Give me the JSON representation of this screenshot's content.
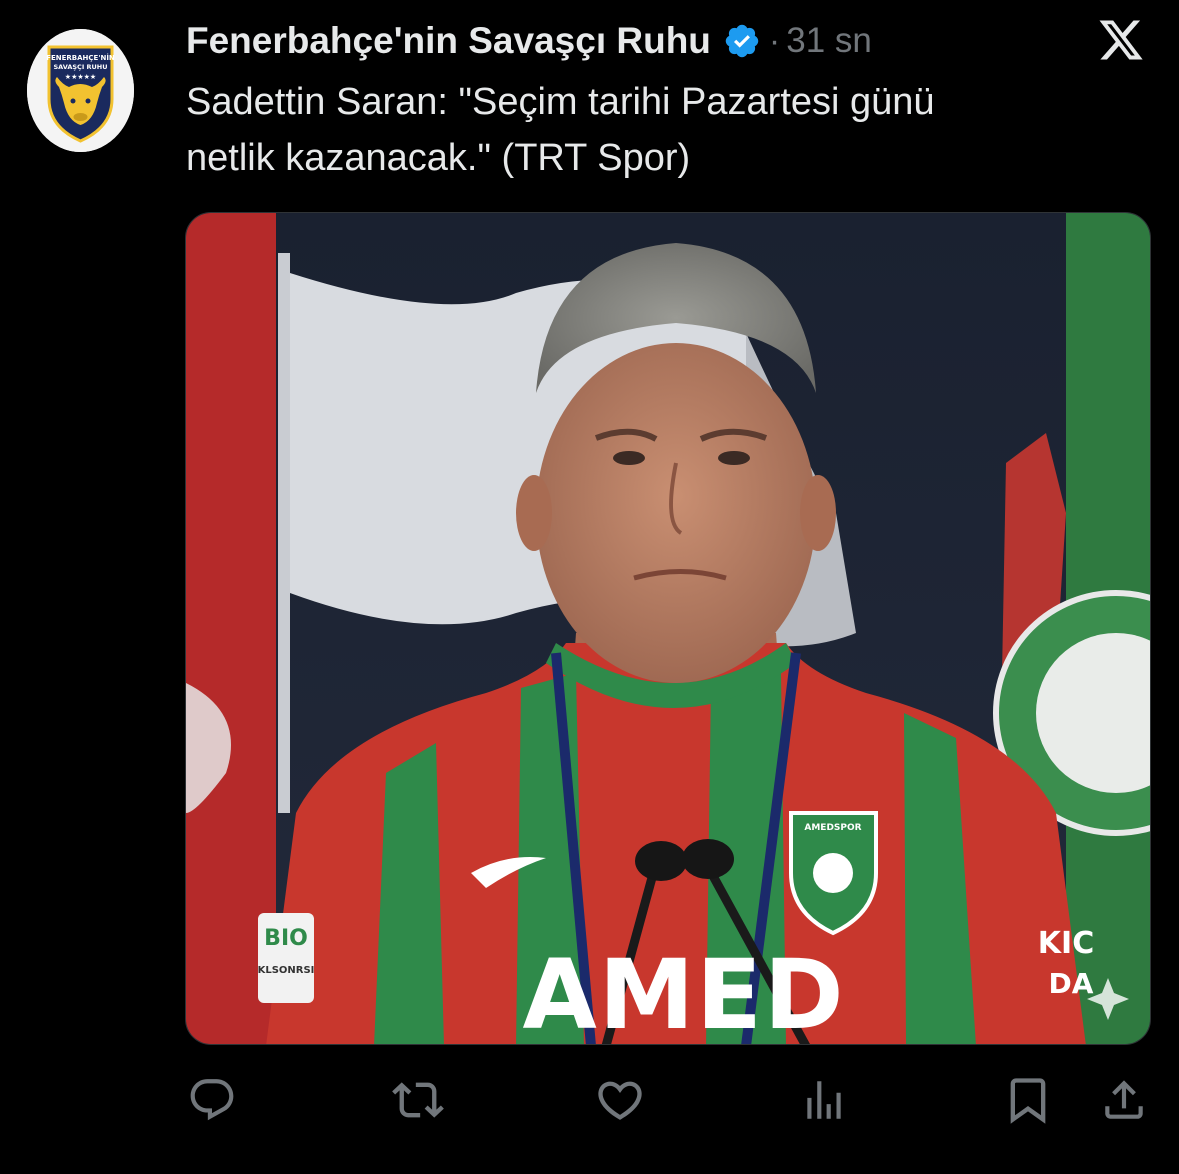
{
  "post": {
    "display_name": "Fenerbahçe'nin Savaşçı Ruhu",
    "verified": true,
    "separator": "·",
    "timestamp": "31 sn",
    "text_lines": [
      "Sadettin Saran: \"Seçim tarihi Pazartesi günü",
      "netlik kazanacak.\" (TRT Spor)"
    ]
  },
  "avatar": {
    "logo_text_top": "FENERBAHÇE'NİN",
    "logo_text_bottom": "SAVAŞÇI RUHU",
    "stars": "★★★★★"
  },
  "media": {
    "jersey_text": "AMED",
    "badge_text": "AMEDSPOR",
    "sponsor_left_top": "BIO",
    "sponsor_left_bottom": "KLSONRSI",
    "sponsor_right_top": "KIC",
    "sponsor_right_bottom": "DA"
  },
  "actions": {
    "icons": [
      "reply-icon",
      "repost-icon",
      "like-icon",
      "views-icon",
      "bookmark-icon",
      "share-icon"
    ]
  },
  "colors": {
    "background": "#000000",
    "text_primary": "#e7e9ea",
    "text_secondary": "#71767b",
    "verified_blue": "#1d9bf0",
    "jersey_red": "#c8372d",
    "jersey_green": "#2f8a4a"
  }
}
